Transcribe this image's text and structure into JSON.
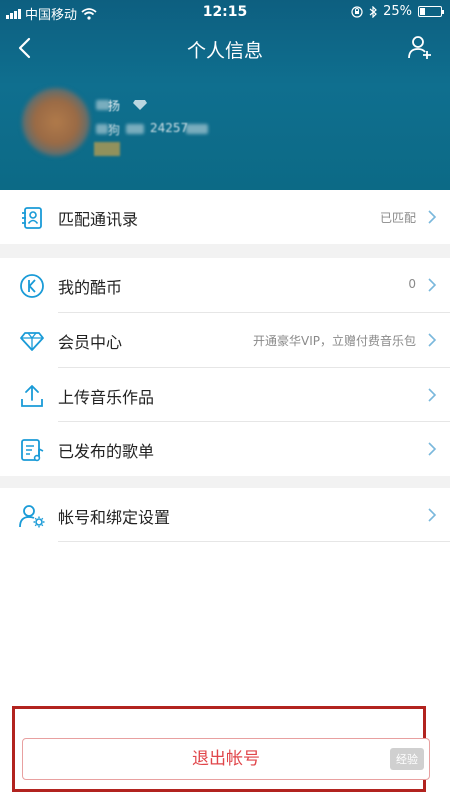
{
  "status_bar": {
    "carrier": "中国移动",
    "time": "12:15",
    "battery": "25%",
    "battery_level": 0.25
  },
  "nav": {
    "title": "个人信息"
  },
  "profile": {
    "name_fragment": "扬",
    "id_fragment": "狗",
    "number_fragment": "24257"
  },
  "menu": {
    "contacts": {
      "label": "匹配通讯录",
      "value": "已匹配"
    },
    "coins": {
      "label": "我的酷币",
      "value": "0"
    },
    "vip": {
      "label": "会员中心",
      "value": "开通豪华VIP，立赠付费音乐包"
    },
    "upload": {
      "label": "上传音乐作品",
      "value": ""
    },
    "playlists": {
      "label": "已发布的歌单",
      "value": ""
    },
    "account": {
      "label": "帐号和绑定设置",
      "value": ""
    }
  },
  "logout": {
    "label": "退出帐号"
  },
  "watermark": {
    "text": "经验"
  },
  "colors": {
    "accent": "#1a9bd7",
    "header_bg": "#0f6f8f",
    "logout_text": "#e0454a",
    "highlight": "#b2231f"
  }
}
